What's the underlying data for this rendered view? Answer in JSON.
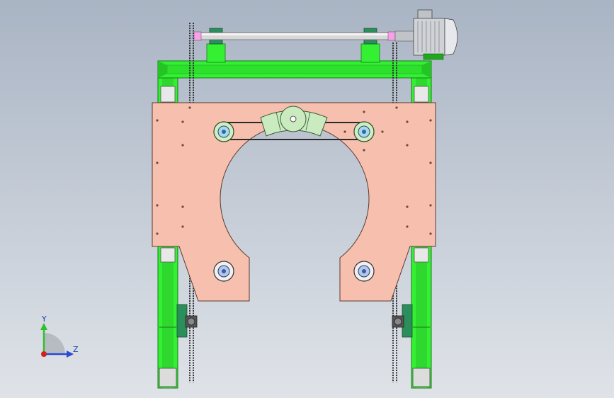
{
  "triad": {
    "y_label": "Y",
    "z_label": "Z"
  },
  "colors": {
    "plate": "#f7bfae",
    "frame": "#33f033",
    "frame_dark": "#1fa81f",
    "rod": "#d8d8d8",
    "motor": "#cfd2d6",
    "sprocket": "#a8d9e8",
    "gear_segment": "#c9ebbf",
    "coupling": "#f3a3e6",
    "background_top": "#a9b4c4",
    "background_bottom": "#dfe3e8"
  }
}
